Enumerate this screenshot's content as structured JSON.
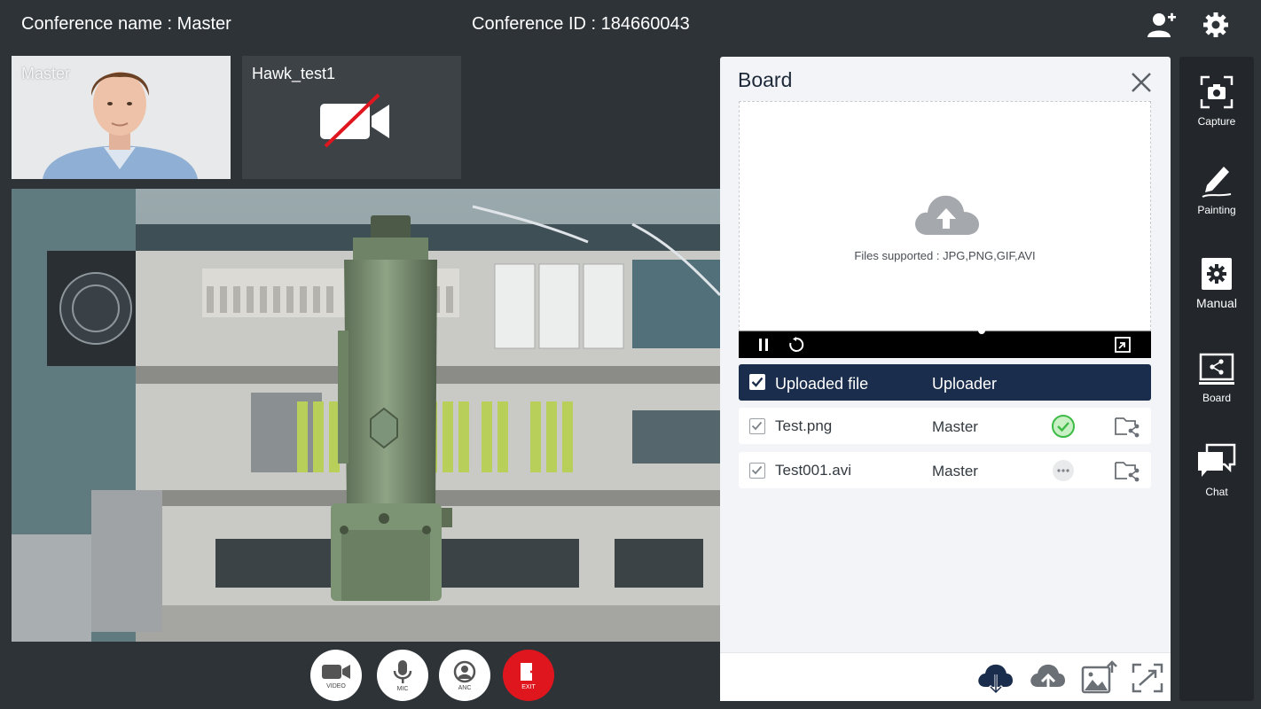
{
  "header": {
    "conference_name": "Conference name : Master",
    "conference_id": "Conference ID : 184660043",
    "icons": [
      "add-user-icon",
      "gear-icon"
    ]
  },
  "tiles": [
    {
      "label": "Master",
      "video": "on"
    },
    {
      "label": "Hawk_test1",
      "video": "off"
    }
  ],
  "controls": [
    {
      "label": "VIDEO",
      "icon": "video-camera-icon"
    },
    {
      "label": "MIC",
      "icon": "microphone-icon"
    },
    {
      "label": "ANC",
      "icon": "anc-icon"
    },
    {
      "label": "EXIT",
      "icon": "exit-icon",
      "color": "#e0161e"
    }
  ],
  "board": {
    "title": "Board",
    "files_supported": "Files supported : JPG,PNG,GIF,AVI",
    "player_progress": 0.59,
    "table": {
      "headers": {
        "file": "Uploaded file",
        "uploader": "Uploader"
      },
      "rows": [
        {
          "file": "Test.png",
          "uploader": "Master",
          "status": "complete"
        },
        {
          "file": "Test001.avi",
          "uploader": "Master",
          "status": "pending"
        }
      ]
    },
    "footer_icons": [
      "cloud-download-icon",
      "cloud-upload-icon",
      "image-upload-icon",
      "expand-icon"
    ],
    "accent": "#1b2d4c"
  },
  "toolbar": {
    "items": [
      {
        "label": "Capture",
        "icon": "camera-capture-icon"
      },
      {
        "label": "Painting",
        "icon": "pen-icon"
      },
      {
        "label": "Manual",
        "icon": "gear-icon",
        "active": true
      },
      {
        "label": "Board",
        "icon": "board-share-icon"
      },
      {
        "label": "Chat",
        "icon": "chat-icon"
      }
    ]
  }
}
